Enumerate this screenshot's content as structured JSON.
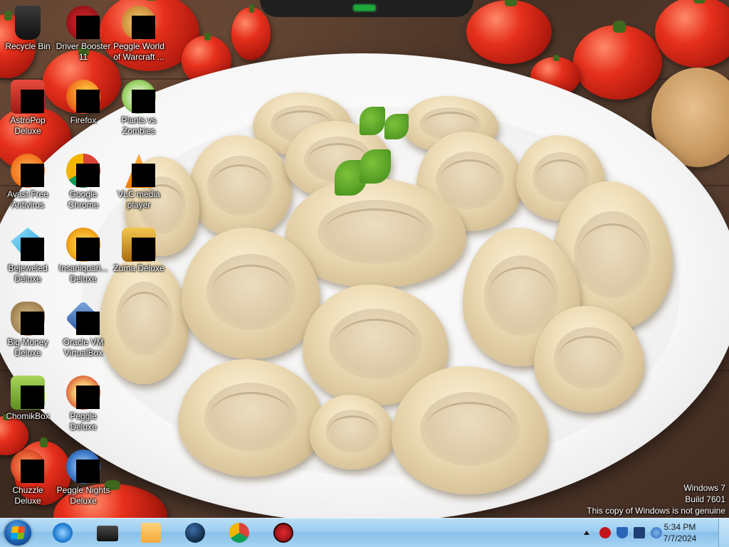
{
  "desktop": {
    "icons": [
      {
        "label": "Recycle Bin",
        "icon": "recycle-bin-icon",
        "color": "#2a2a2a"
      },
      {
        "label": "Driver Booster\n11",
        "icon": "driver-booster-icon",
        "color": "#c0151b"
      },
      {
        "label": "Peggle World\nof Warcraft ...",
        "icon": "peggle-wow-icon",
        "color": "#e7a43a"
      },
      {
        "label": "AstroPop\nDeluxe",
        "icon": "astropop-icon",
        "color": "#d72d2d"
      },
      {
        "label": "Firefox",
        "icon": "firefox-icon",
        "color": "#f28a1c"
      },
      {
        "label": "Plants vs\nZombies",
        "icon": "plants-vs-zombies-icon",
        "color": "#4f9a2c"
      },
      {
        "label": "Avast Free\nAntivirus",
        "icon": "avast-icon",
        "color": "#f47b20"
      },
      {
        "label": "Google\nChrome",
        "icon": "chrome-icon",
        "color": "#db4437"
      },
      {
        "label": "VLC media\nplayer",
        "icon": "vlc-icon",
        "color": "#f48b00"
      },
      {
        "label": "Bejeweled\nDeluxe",
        "icon": "bejeweled-icon",
        "color": "#27a9d8"
      },
      {
        "label": "Insaniquari...\nDeluxe",
        "icon": "insaniquarium-icon",
        "color": "#f2b531"
      },
      {
        "label": "Zuma Deluxe",
        "icon": "zuma-icon",
        "color": "#c98a1e"
      },
      {
        "label": "Big Money\nDeluxe",
        "icon": "big-money-icon",
        "color": "#9b7b4c"
      },
      {
        "label": "Oracle VM\nVirtualBox",
        "icon": "virtualbox-icon",
        "color": "#1f4f9b"
      },
      {
        "label": "ChomikBox",
        "icon": "chomikbox-icon",
        "color": "#8bbf3a"
      },
      {
        "label": "Peggle Deluxe",
        "icon": "peggle-icon",
        "color": "#d94c2f"
      },
      {
        "label": "Chuzzle\nDeluxe",
        "icon": "chuzzle-icon",
        "color": "#e0542a"
      },
      {
        "label": "Peggle Nights\nDeluxe",
        "icon": "peggle-nights-icon",
        "color": "#3a78c8"
      }
    ]
  },
  "watermark": {
    "line1": "Windows 7",
    "line2": "Build 7601",
    "line3": "This copy of Windows is not genuine"
  },
  "taskbar": {
    "start": "windows-start-orb-icon",
    "pinned": [
      {
        "icon": "internet-explorer-icon",
        "color": "#1f7fd6"
      },
      {
        "icon": "media-center-icon",
        "color": "#1b1b1b"
      },
      {
        "icon": "windows-media-player-icon",
        "color": "#f2a83a"
      },
      {
        "icon": "globe-app-icon",
        "color": "#0d2744"
      },
      {
        "icon": "chrome-icon",
        "color": "#db4437"
      },
      {
        "icon": "driver-booster-icon",
        "color": "#c0151b"
      }
    ],
    "tray": [
      {
        "icon": "show-hidden-icons-chevron-icon"
      },
      {
        "icon": "driver-booster-tray-icon",
        "color": "#c0151b"
      },
      {
        "icon": "security-shield-icon",
        "color": "#2a66b8"
      },
      {
        "icon": "network-monitor-icon",
        "color": "#1d3f73"
      },
      {
        "icon": "volume-network-icon",
        "color": "#2a66b8"
      }
    ],
    "clock": {
      "time": "5:34 PM",
      "date": "7/7/2024"
    }
  }
}
